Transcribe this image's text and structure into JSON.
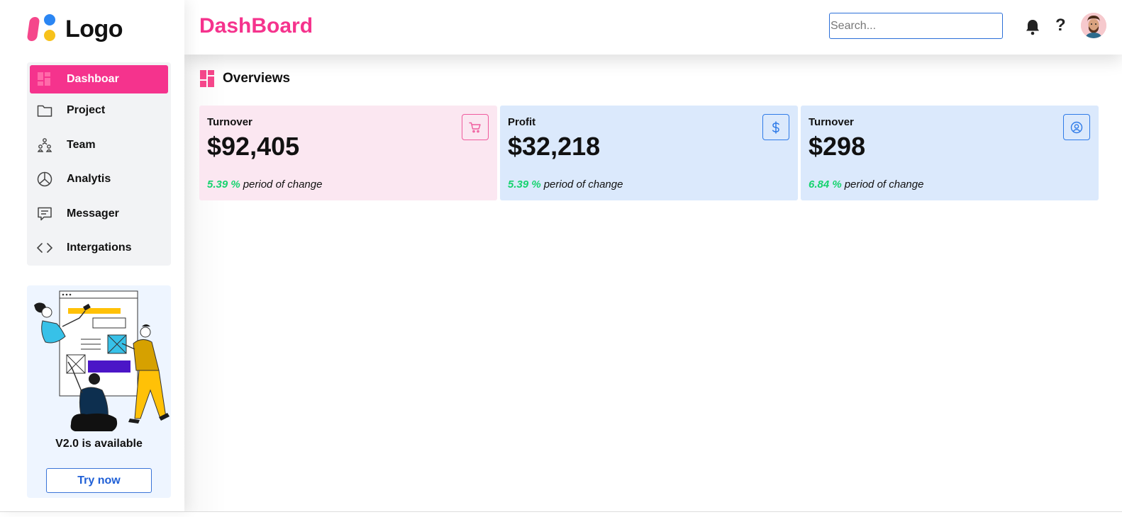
{
  "logo": {
    "text": "Logo"
  },
  "sidebar": {
    "items": [
      {
        "label": "Dashboar",
        "icon": "dashboard-grid-icon",
        "active": true
      },
      {
        "label": "Project",
        "icon": "folder-icon"
      },
      {
        "label": "Team",
        "icon": "team-icon"
      },
      {
        "label": "Analytis",
        "icon": "pie-chart-icon"
      },
      {
        "label": "Messager",
        "icon": "message-icon"
      },
      {
        "label": "Intergations",
        "icon": "code-brackets-icon"
      }
    ],
    "promo": {
      "title": "V2.0 is available",
      "button": "Try now"
    }
  },
  "header": {
    "title": "DashBoard",
    "search_placeholder": "Search...",
    "help_label": "?"
  },
  "main": {
    "section_title": "Overviews",
    "cards": [
      {
        "label": "Turnover",
        "value": "$92,405",
        "change_pct": "5.39 %",
        "change_text": "period of change",
        "icon": "cart-icon",
        "color": "#fbe7f1"
      },
      {
        "label": "Profit",
        "value": "$32,218",
        "change_pct": "5.39 %",
        "change_text": "period of change",
        "icon": "dollar-icon",
        "color": "#dbe9fc"
      },
      {
        "label": "Turnover",
        "value": "$298",
        "change_pct": "6.84 %",
        "change_text": "period of change",
        "icon": "user-circle-icon",
        "color": "#dbe9fc"
      }
    ]
  },
  "colors": {
    "accent": "#f5338d",
    "primary": "#2f7be8",
    "positive": "#17d36f"
  }
}
